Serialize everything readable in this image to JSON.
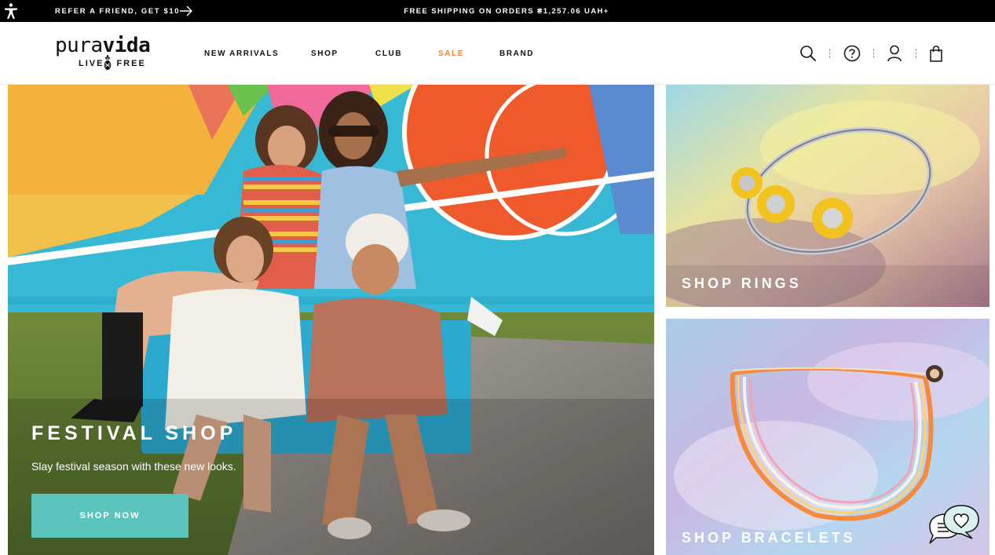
{
  "topbar": {
    "refer_text": "REFER A FRIEND, GET $10",
    "shipping_text": "FREE SHIPPING ON ORDERS ₴1,257.06 UAH+"
  },
  "logo": {
    "word_light": "pura",
    "word_bold": "vida",
    "tag_left": "LIVE",
    "tag_right": "FREE"
  },
  "nav": [
    {
      "label": "NEW ARRIVALS"
    },
    {
      "label": "SHOP"
    },
    {
      "label": "CLUB"
    },
    {
      "label": "SALE"
    },
    {
      "label": "BRAND"
    }
  ],
  "colors": {
    "sale": "#f0873a",
    "button": "#5bc5bd"
  },
  "icons": [
    "accessibility-icon",
    "arrow-right-icon",
    "search-icon",
    "help-icon",
    "account-icon",
    "bag-icon",
    "chat-icon"
  ],
  "hero": {
    "title": "FESTIVAL SHOP",
    "subtitle": "Slay festival season with these new looks.",
    "button": "SHOP NOW"
  },
  "panels": [
    {
      "label": "SHOP RINGS"
    },
    {
      "label": "SHOP BRACELETS"
    }
  ]
}
